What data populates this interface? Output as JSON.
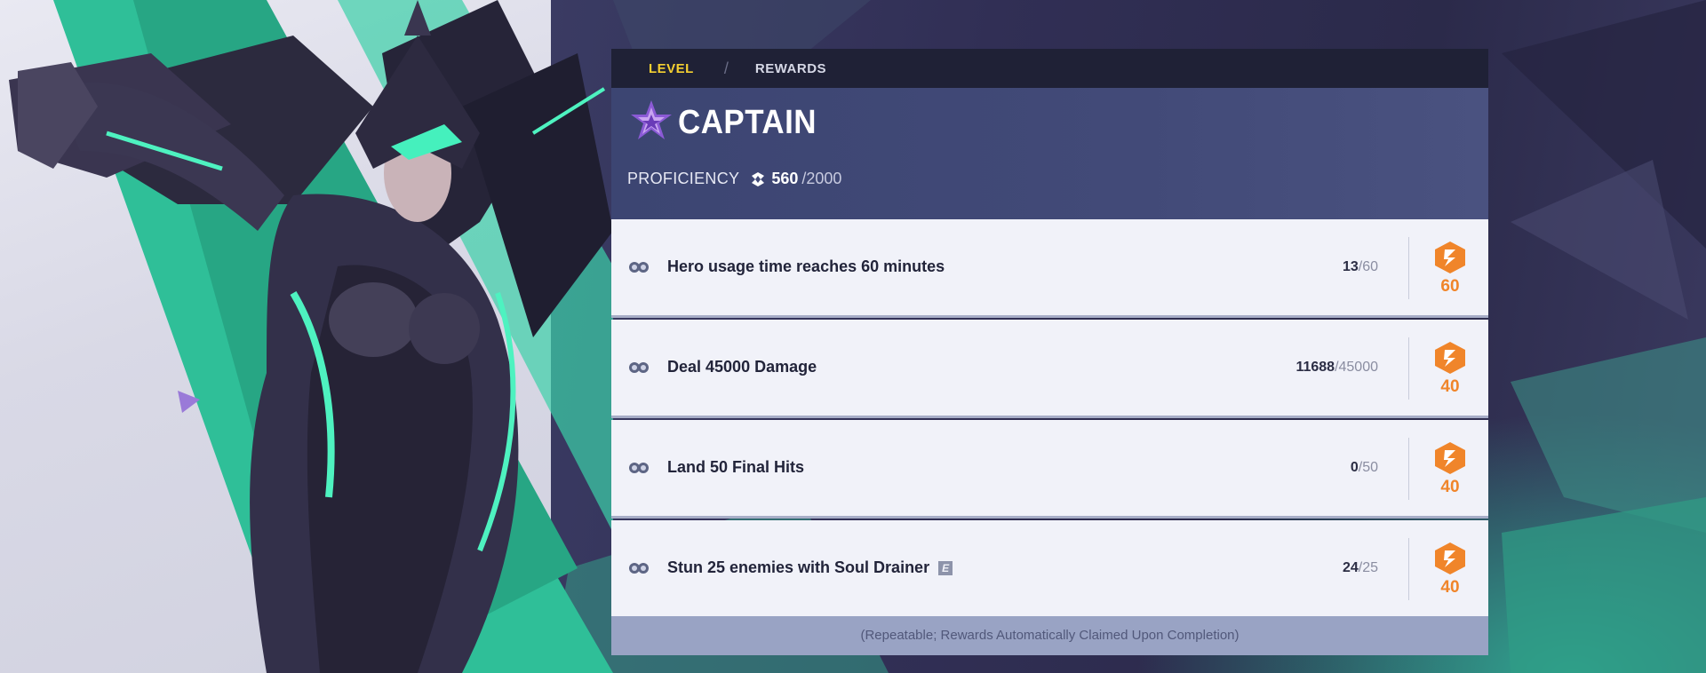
{
  "tabs": [
    {
      "label": "LEVEL",
      "active": true
    },
    {
      "label": "REWARDS",
      "active": false
    }
  ],
  "tab_separator": "/",
  "role": {
    "title": "CAPTAIN",
    "icon": "captain-star-icon"
  },
  "proficiency": {
    "label": "PROFICIENCY",
    "current": "560",
    "max": "/2000",
    "fraction": 0.28,
    "icon": "proficiency-icon"
  },
  "tasks": [
    {
      "text": "Hero usage time reaches 60 minutes",
      "current": "13",
      "total": "/60",
      "reward": "60",
      "tag": ""
    },
    {
      "text": "Deal 45000 Damage",
      "current": "11688",
      "total": "/45000",
      "reward": "40",
      "tag": ""
    },
    {
      "text": "Land 50 Final Hits",
      "current": "0",
      "total": "/50",
      "reward": "40",
      "tag": ""
    },
    {
      "text": "Stun 25 enemies with Soul Drainer",
      "current": "24",
      "total": "/25",
      "reward": "40",
      "tag": "E"
    }
  ],
  "footer_note": "(Repeatable; Rewards Automatically Claimed Upon Completion)",
  "colors": {
    "accent_yellow": "#f5d031",
    "progress_fill": "#f4b928",
    "reward_orange": "#f0852a",
    "header_blue": "#424a78"
  }
}
